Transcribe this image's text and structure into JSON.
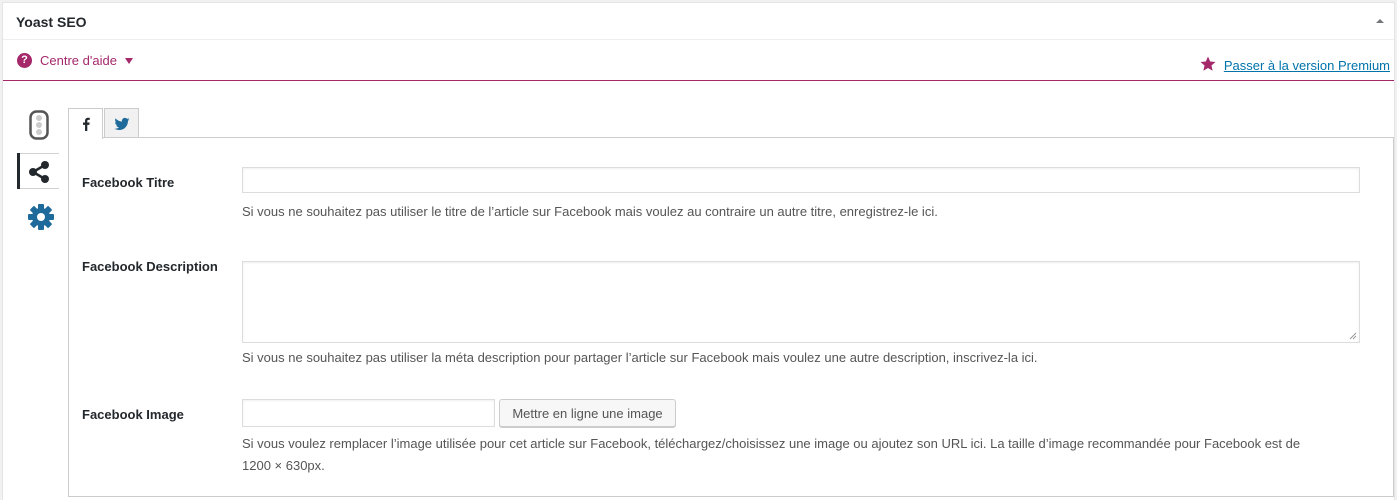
{
  "metabox": {
    "title": "Yoast SEO",
    "toggle_icon": "triangle-up-icon"
  },
  "help_center": {
    "label": "Centre d'aide",
    "icon": "question-circle-icon"
  },
  "premium": {
    "link_text": "Passer à la version Premium",
    "icon": "star-icon"
  },
  "side_tabs": [
    {
      "name": "readability-traffic-light",
      "icon": "traffic-light-icon"
    },
    {
      "name": "social",
      "icon": "share-icon",
      "active": true
    },
    {
      "name": "advanced",
      "icon": "gear-icon"
    }
  ],
  "social_tabs": [
    {
      "name": "facebook",
      "icon": "facebook-icon",
      "active": true
    },
    {
      "name": "twitter",
      "icon": "twitter-icon",
      "active": false
    }
  ],
  "fields": {
    "title": {
      "label": "Facebook Titre",
      "value": "",
      "description": "Si vous ne souhaitez pas utiliser le titre de l’article sur Facebook mais voulez au contraire un autre titre, enregistrez-le ici."
    },
    "description": {
      "label": "Facebook Description",
      "value": "",
      "description": "Si vous ne souhaitez pas utiliser la méta description pour partager l’article sur Facebook mais voulez une autre description, inscrivez-la ici."
    },
    "image": {
      "label": "Facebook Image",
      "value": "",
      "button_label": "Mettre en ligne une image",
      "description_line1": "Si vous voulez remplacer l’image utilisée pour cet article sur Facebook, téléchargez/choisissez une image ou ajoutez son URL ici. La taille d’image recommandée pour Facebook est de",
      "description_line2": "1200 × 630px."
    }
  },
  "colors": {
    "brand": "#a4286a",
    "link": "#0073aa",
    "icon_blue": "#1e6a9a"
  }
}
